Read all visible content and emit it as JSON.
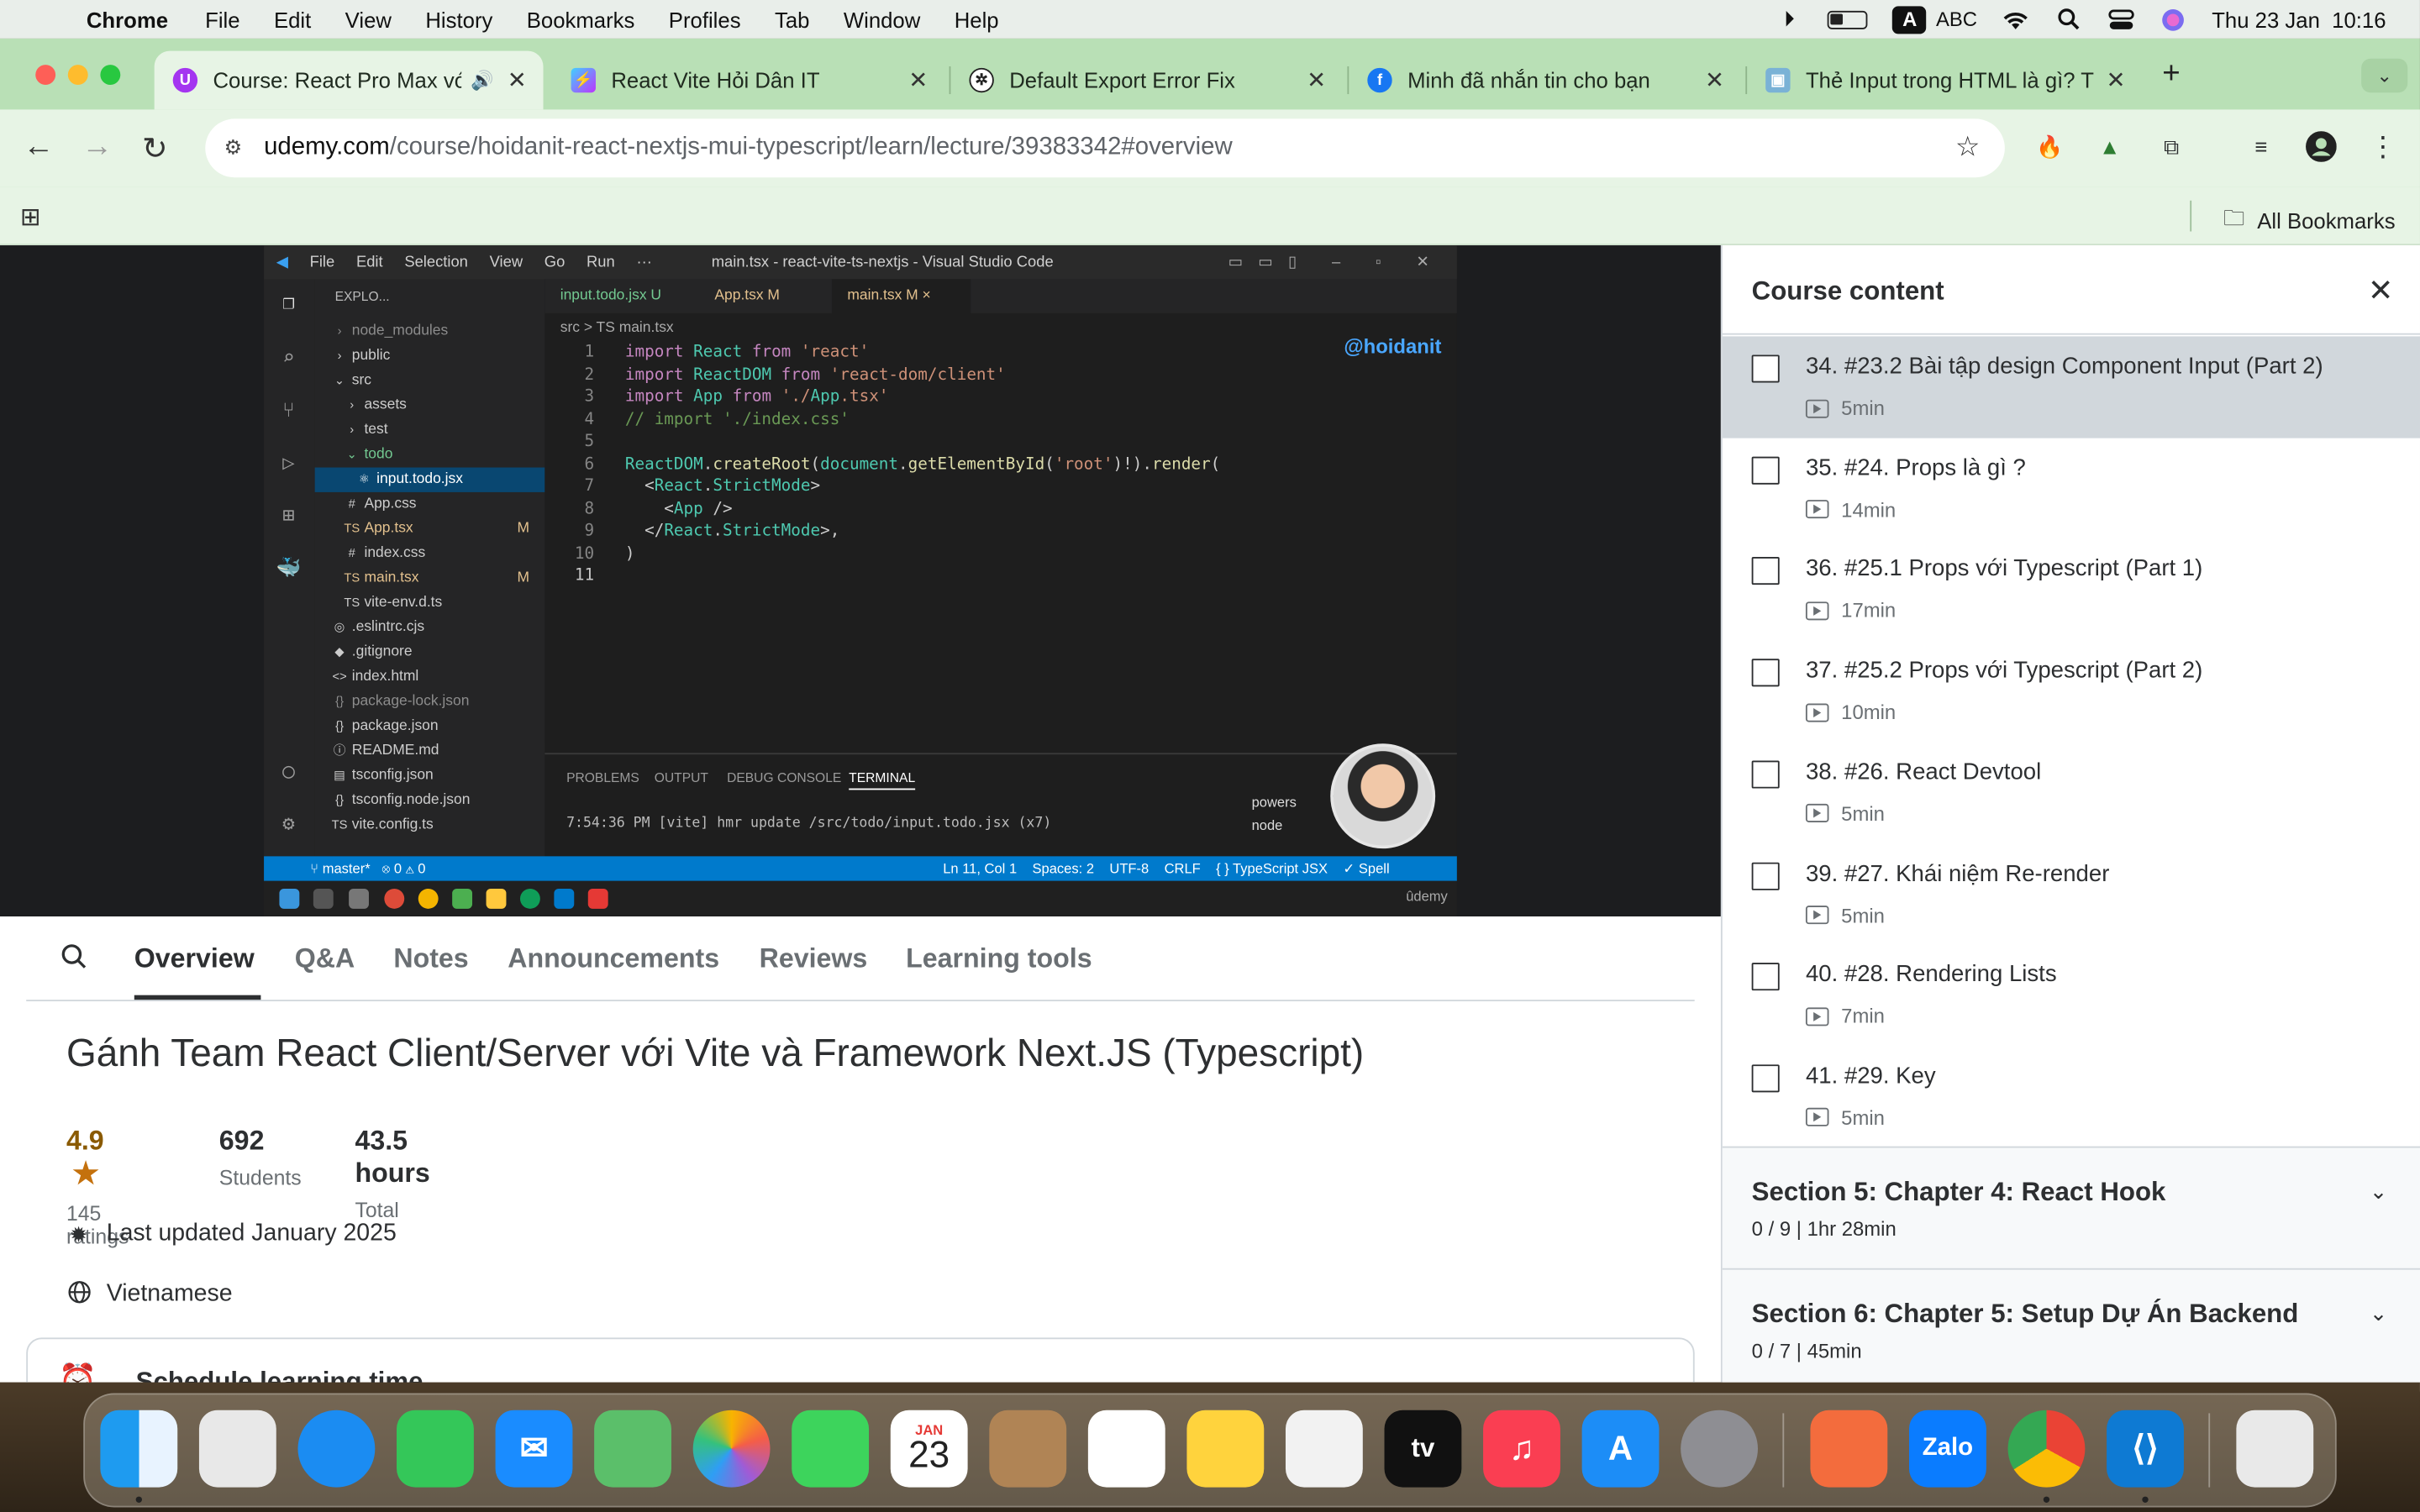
{
  "menubar": {
    "app": "Chrome",
    "items": [
      "File",
      "Edit",
      "View",
      "History",
      "Bookmarks",
      "Profiles",
      "Tab",
      "Window",
      "Help"
    ],
    "input_source": "ABC",
    "input_badge": "A",
    "datetime": "Thu 23 Jan  10:16"
  },
  "browser": {
    "tabs": [
      {
        "title": "Course: React Pro Max với",
        "favicon": "udemy-icon",
        "active": true,
        "audio": true
      },
      {
        "title": "React Vite Hỏi Dân IT",
        "favicon": "vite-icon"
      },
      {
        "title": "Default Export Error Fix",
        "favicon": "chatgpt-icon"
      },
      {
        "title": "Minh đã nhắn tin cho bạn",
        "favicon": "facebook-icon"
      },
      {
        "title": "Thẻ Input trong HTML là gì? T",
        "favicon": "cube-icon"
      }
    ],
    "url_host": "udemy.com",
    "url_path": "/course/hoidanit-react-nextjs-mui-typescript/learn/lecture/39383342#overview",
    "all_bookmarks": "All Bookmarks"
  },
  "vscode": {
    "menu": [
      "File",
      "Edit",
      "Selection",
      "View",
      "Go",
      "Run",
      "···"
    ],
    "window_title": "main.tsx - react-vite-ts-nextjs - Visual Studio Code",
    "explorer_title": "EXPLO...",
    "watermark": "@hoidanit",
    "tree": [
      {
        "label": "node_modules",
        "icon": "›",
        "indent": 0,
        "color": "#8c8c8c"
      },
      {
        "label": "public",
        "icon": "›",
        "indent": 0,
        "color": "#cccccc"
      },
      {
        "label": "src",
        "icon": "⌄",
        "indent": 0,
        "color": "#cccccc"
      },
      {
        "label": "assets",
        "icon": "›",
        "indent": 1,
        "color": "#cccccc"
      },
      {
        "label": "test",
        "icon": "›",
        "indent": 1,
        "color": "#cccccc"
      },
      {
        "label": "todo",
        "icon": "⌄",
        "indent": 1,
        "color": "#73c991"
      },
      {
        "label": "input.todo.jsx",
        "icon": "⚛",
        "indent": 2,
        "color": "#ffffff",
        "selected": true
      },
      {
        "label": "App.css",
        "icon": "#",
        "indent": 1,
        "color": "#cccccc"
      },
      {
        "label": "App.tsx",
        "icon": "TS",
        "indent": 1,
        "color": "#e2c08d",
        "badge": "M"
      },
      {
        "label": "index.css",
        "icon": "#",
        "indent": 1,
        "color": "#cccccc"
      },
      {
        "label": "main.tsx",
        "icon": "TS",
        "indent": 1,
        "color": "#e2c08d",
        "badge": "M"
      },
      {
        "label": "vite-env.d.ts",
        "icon": "TS",
        "indent": 1,
        "color": "#cccccc"
      },
      {
        "label": ".eslintrc.cjs",
        "icon": "◎",
        "indent": 0,
        "color": "#cccccc"
      },
      {
        "label": ".gitignore",
        "icon": "◆",
        "indent": 0,
        "color": "#cccccc"
      },
      {
        "label": "index.html",
        "icon": "<>",
        "indent": 0,
        "color": "#cccccc"
      },
      {
        "label": "package-lock.json",
        "icon": "{}",
        "indent": 0,
        "color": "#8c8c8c"
      },
      {
        "label": "package.json",
        "icon": "{}",
        "indent": 0,
        "color": "#cccccc"
      },
      {
        "label": "README.md",
        "icon": "ⓘ",
        "indent": 0,
        "color": "#cccccc"
      },
      {
        "label": "tsconfig.json",
        "icon": "▤",
        "indent": 0,
        "color": "#cccccc"
      },
      {
        "label": "tsconfig.node.json",
        "icon": "{}",
        "indent": 0,
        "color": "#cccccc"
      },
      {
        "label": "vite.config.ts",
        "icon": "TS",
        "indent": 0,
        "color": "#cccccc"
      }
    ],
    "editor_tabs": [
      {
        "label": "input.todo.jsx  U",
        "active": false
      },
      {
        "label": "App.tsx  M",
        "active": false
      },
      {
        "label": "main.tsx  M  ×",
        "active": true
      }
    ],
    "breadcrumb": "src  >  TS main.tsx",
    "code": [
      "import React from 'react'",
      "import ReactDOM from 'react-dom/client'",
      "import App from './App.tsx'",
      "// import './index.css'",
      "",
      "ReactDOM.createRoot(document.getElementById('root')!).render(",
      "  <React.StrictMode>",
      "    <App />",
      "  </React.StrictMode>,",
      ")",
      ""
    ],
    "panel_tabs": [
      "PROBLEMS",
      "OUTPUT",
      "DEBUG CONSOLE",
      "TERMINAL"
    ],
    "terminal_line": "7:54:36 PM [vite] hmr update /src/todo/input.todo.jsx (x7)",
    "terminal_sessions": [
      "powers",
      "node"
    ],
    "status_left": "⑂ master*   ⊗ 0 ⚠ 0",
    "status_right": "Ln 11, Col 1    Spaces: 2    UTF-8    CRLF    { } TypeScript JSX    ✓ Spell",
    "taskbar_brand": "ûdemy"
  },
  "course": {
    "nav": [
      "Overview",
      "Q&A",
      "Notes",
      "Announcements",
      "Reviews",
      "Learning tools"
    ],
    "title": "Gánh Team React Client/Server với Vite và Framework Next.JS (Typescript)",
    "rating": "4.9",
    "ratings_label": "145 ratings",
    "students": "692",
    "students_label": "Students",
    "hours": "43.5 hours",
    "hours_label": "Total",
    "last_updated": "Last updated January 2025",
    "language": "Vietnamese",
    "schedule": "Schedule learning time"
  },
  "sidebar": {
    "title": "Course content",
    "lectures": [
      {
        "title": "34. #23.2 Bài tập design Component Input (Part 2)",
        "duration": "5min",
        "active": true
      },
      {
        "title": "35. #24. Props là gì ?",
        "duration": "14min"
      },
      {
        "title": "36. #25.1 Props với Typescript (Part 1)",
        "duration": "17min"
      },
      {
        "title": "37. #25.2 Props với Typescript (Part 2)",
        "duration": "10min"
      },
      {
        "title": "38. #26. React Devtool",
        "duration": "5min"
      },
      {
        "title": "39. #27. Khái niệm Re-render",
        "duration": "5min"
      },
      {
        "title": "40. #28. Rendering Lists",
        "duration": "7min"
      },
      {
        "title": "41. #29. Key",
        "duration": "5min"
      }
    ],
    "sections": [
      {
        "title": "Section 5: Chapter 4: React Hook",
        "sub": "0 / 9 | 1hr 28min"
      },
      {
        "title": "Section 6: Chapter 5: Setup Dự Án Backend",
        "sub": "0 / 7 | 45min"
      }
    ]
  },
  "dock": {
    "calendar_month": "JAN",
    "calendar_day": "23",
    "appletv": "tv",
    "zalo": "Zalo",
    "apps": [
      "finder-icon",
      "launchpad-icon",
      "safari-icon",
      "messages-icon",
      "mail-icon",
      "maps-icon",
      "photos-icon",
      "facetime-icon",
      "calendar-icon",
      "contacts-icon",
      "reminders-icon",
      "notes-icon",
      "freeform-icon",
      "appletv-icon",
      "music-icon",
      "appstore-icon",
      "settings-icon",
      "pen-icon",
      "zalo-icon",
      "chrome-icon",
      "vscode-icon",
      "trash-icon"
    ]
  }
}
